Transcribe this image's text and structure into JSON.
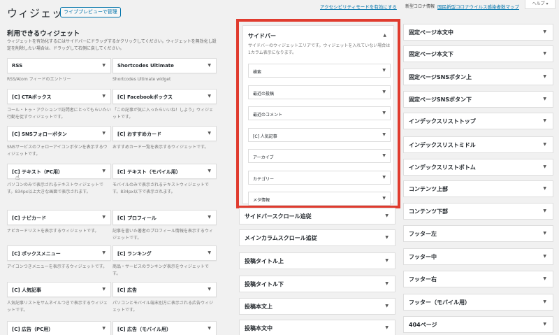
{
  "header": {
    "title": "ウィジェット",
    "live_preview_label": "ライブプレビューで管理",
    "accessibility_link": "アクセシビリティモードを有効にする",
    "covid_label": "新型コロナ情報",
    "covid_link": "国民新型コロナウイルス感染者数マップ",
    "help_label": "ヘルプ ▾"
  },
  "available": {
    "title": "利用できるウィジェット",
    "description": "ウィジェットを有効化するにはサイドバーにドラッグするかクリックしてください。ウィジェットを無効化し設定を削除したい場合は、ドラッグして右側に戻してください。",
    "widgets": [
      {
        "title": "RSS",
        "desc": "RSS/Atom フィードのエントリー"
      },
      {
        "title": "Shortcodes Ultimate",
        "desc": "Shortcodes Ultimate widget"
      },
      {
        "title": "[C] CTAボックス",
        "desc": "コール・トゥ・アクションで訪問者にとってもらいたい行動を促すウィジェットです。"
      },
      {
        "title": "[C] Facebookボックス",
        "desc": "「この記事が気に入ったらいいね！しよう」ウィジェットです。"
      },
      {
        "title": "[C] SNSフォローボタン",
        "desc": "SNSサービスのフォローアイコンボタンを表示するウィジェットです。"
      },
      {
        "title": "[C] おすすめカード",
        "desc": "おすすめカード一覧を表示するウィジェットです。"
      },
      {
        "title": "[C] テキスト（PC用）",
        "desc": "パソコンのみで表示されるテキストウィジェットです。834px以上大きな画面で表示されます。"
      },
      {
        "title": "[C] テキスト（モバイル用）",
        "desc": "モバイルのみで表示されるテキストウィジェットです。834px以下で表示されます。"
      },
      {
        "title": "[C] ナビカード",
        "desc": "ナビカードリストを表示するウィジェットです。"
      },
      {
        "title": "[C] プロフィール",
        "desc": "記事を書いた著者のプロフィール情報を表示するウィジェットです。"
      },
      {
        "title": "[C] ボックスメニュー",
        "desc": "アイコンつきメニューを表示するウィジェットです。"
      },
      {
        "title": "[C] ランキング",
        "desc": "商品・サービスのランキング表示をウィジェットです。"
      },
      {
        "title": "[C] 人気記事",
        "desc": "人気記事リストをサムネイルつきで表示するウィジェットです。"
      },
      {
        "title": "[C] 広告",
        "desc": "パソコンとモバイル端末別方に表示される広告ウィジェットです。"
      },
      {
        "title": "[C] 広告（PC用）",
        "desc": ""
      },
      {
        "title": "[C] 広告（モバイル用）",
        "desc": ""
      }
    ]
  },
  "sidebar": {
    "title": "サイドバー",
    "description": "サイドバーのウィジェットエリアです。ウィジェットを入れていない場合は1カラム表示になります。",
    "items": [
      "検索",
      "最近の投稿",
      "最近のコメント",
      "[C] 人気記事",
      "アーカイブ",
      "カテゴリー",
      "メタ情報"
    ]
  },
  "middle_areas": [
    "サイドバースクロール追従",
    "メインカラムスクロール追従",
    "投稿タイトル上",
    "投稿タイトル下",
    "投稿本文上",
    "投稿本文中"
  ],
  "right_areas": [
    "固定ページ本文中",
    "固定ページ本文下",
    "固定ページSNSボタン上",
    "固定ページSNSボタン下",
    "インデックスリストトップ",
    "インデックスリストミドル",
    "インデックスリストボトム",
    "コンテンツ上部",
    "コンテンツ下部",
    "フッター左",
    "フッター中",
    "フッター右",
    "フッター（モバイル用）",
    "404ページ"
  ],
  "icons": {
    "arrow_down": "▼",
    "arrow_up": "▲"
  }
}
